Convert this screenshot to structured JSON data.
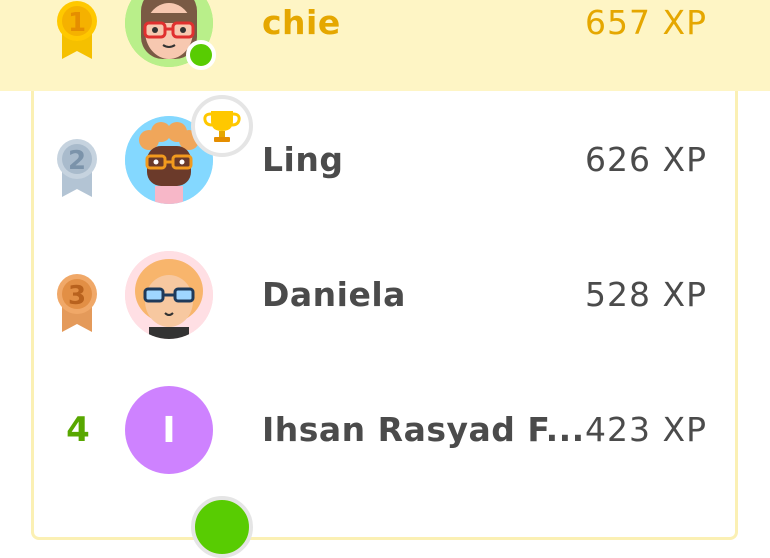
{
  "leaderboard": {
    "rows": [
      {
        "rank": "1",
        "name": "chie",
        "xp": "657 XP",
        "avatar_icon": "girl-red-glasses-avatar",
        "online": true,
        "medal": "gold"
      },
      {
        "rank": "2",
        "name": "Ling",
        "xp": "626 XP",
        "avatar_icon": "curly-hair-glasses-avatar",
        "badge_icon": "trophy-icon",
        "medal": "silver"
      },
      {
        "rank": "3",
        "name": "Daniela",
        "xp": "528 XP",
        "avatar_icon": "blonde-glasses-avatar",
        "medal": "bronze"
      },
      {
        "rank": "4",
        "name": "Ihsan Rasyad F...",
        "xp": "423 XP",
        "avatar_letter": "I"
      }
    ]
  },
  "colors": {
    "highlight_bg": "#fef5c5",
    "gold": "#e5a700",
    "silver": "#8fa6bd",
    "bronze": "#d8833f",
    "green": "#58a700",
    "purple_avatar": "#ce82ff"
  }
}
